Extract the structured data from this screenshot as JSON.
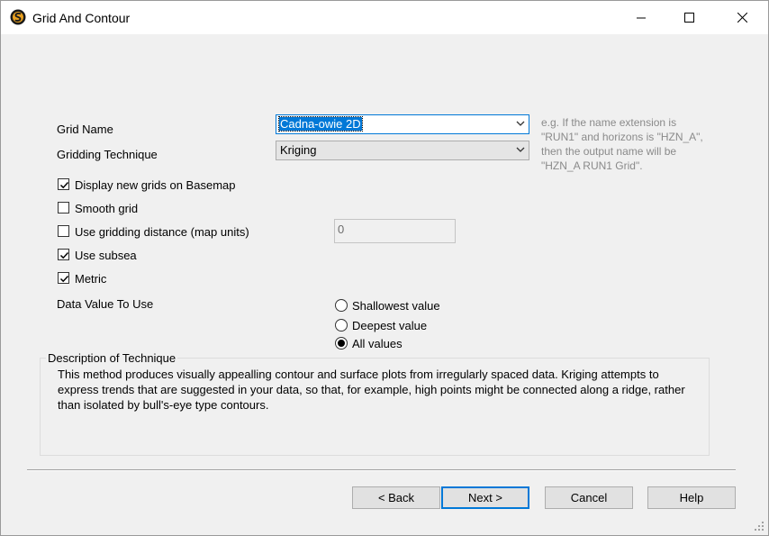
{
  "window": {
    "title": "Grid And Contour",
    "app_icon": "logo-icon",
    "controls": [
      "minimize-icon",
      "maximize-icon",
      "close-icon"
    ]
  },
  "form": {
    "grid_name_label": "Grid Name",
    "grid_name_value": "Cadna-owie 2D",
    "gridding_technique_label": "Gridding Technique",
    "gridding_technique_value": "Kriging",
    "hint_lines": [
      "e.g. If the name extension is",
      "\"RUN1\" and horizons is \"HZN_A\",",
      "then the output name will be",
      "\"HZN_A RUN1 Grid\"."
    ]
  },
  "checkboxes": {
    "display_on_basemap": {
      "label": "Display new grids on Basemap",
      "checked": true
    },
    "smooth_grid": {
      "label": "Smooth grid",
      "checked": false
    },
    "use_gridding_distance": {
      "label": "Use gridding distance (map units)",
      "checked": false
    },
    "use_subsea": {
      "label": "Use subsea",
      "checked": true
    },
    "metric": {
      "label": "Metric",
      "checked": true
    }
  },
  "gridding_distance_value": "0",
  "data_value": {
    "label": "Data Value To Use",
    "options": {
      "shallowest": "Shallowest value",
      "deepest": "Deepest value",
      "all": "All values"
    },
    "selected": "All values"
  },
  "description": {
    "title": "Description of Technique",
    "text": "This method produces visually appealling contour and surface plots from irregularly spaced data.  Kriging attempts to express trends that are suggested in your data, so that, for example, high points might be connected along a ridge, rather than isolated by bull's-eye type contours."
  },
  "buttons": {
    "back": "< Back",
    "next": "Next >",
    "cancel": "Cancel",
    "help": "Help"
  },
  "colors": {
    "accent": "#0078d7",
    "dialog_bg": "#f0f0f0",
    "hint_text": "#8a8a8a"
  }
}
